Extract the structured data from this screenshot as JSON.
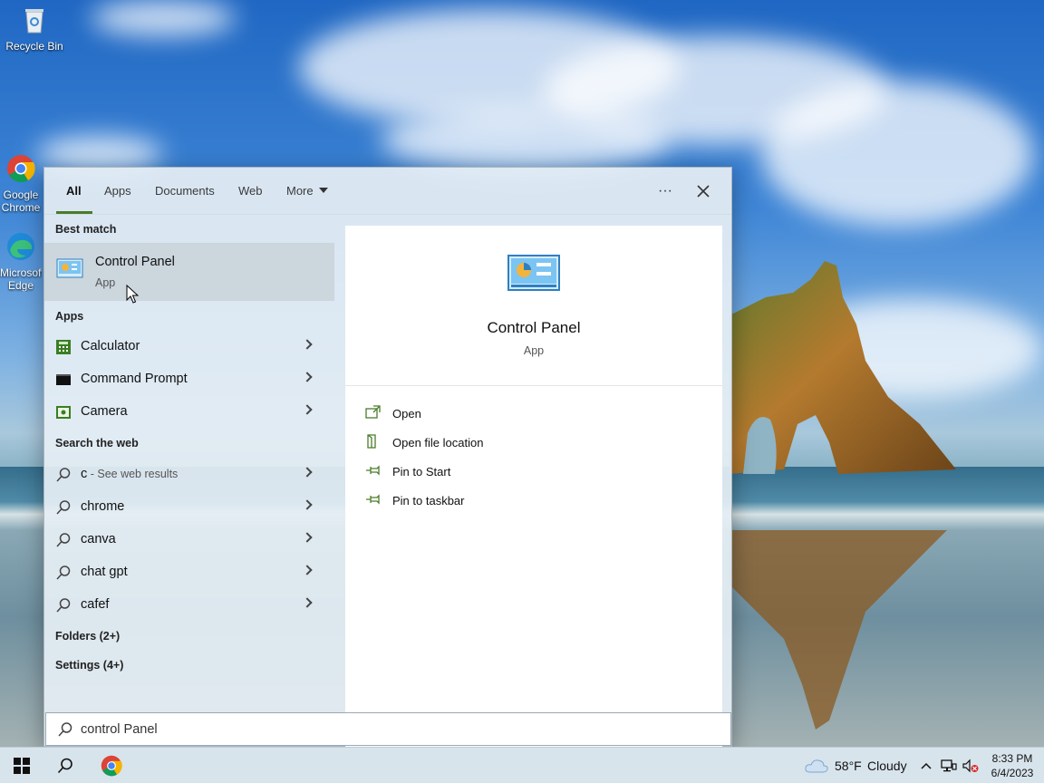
{
  "desktop": {
    "icons": [
      {
        "label": "Recycle Bin",
        "icon": "recycle-bin-icon"
      },
      {
        "label": "Google Chrome",
        "icon": "chrome-icon"
      },
      {
        "label": "Microsoft Edge",
        "icon": "edge-icon"
      }
    ]
  },
  "search": {
    "tabs": [
      {
        "label": "All",
        "active": true
      },
      {
        "label": "Apps"
      },
      {
        "label": "Documents"
      },
      {
        "label": "Web"
      },
      {
        "label": "More"
      }
    ],
    "more_options_label": "···",
    "close_label": "✕",
    "best_match": {
      "heading": "Best match",
      "title": "Control Panel",
      "subtitle": "App",
      "icon": "control-panel-icon"
    },
    "apps": {
      "heading": "Apps",
      "items": [
        {
          "label": "Calculator",
          "icon": "calculator-icon"
        },
        {
          "label": "Command Prompt",
          "icon": "command-prompt-icon"
        },
        {
          "label": "Camera",
          "icon": "camera-icon"
        }
      ]
    },
    "web": {
      "heading": "Search the web",
      "items": [
        {
          "label": "c",
          "sub": " - See web results"
        },
        {
          "label": "chrome"
        },
        {
          "label": "canva"
        },
        {
          "label": "chat gpt"
        },
        {
          "label": "cafef"
        }
      ]
    },
    "folders_label": "Folders (2+)",
    "settings_label": "Settings (4+)",
    "preview": {
      "title": "Control Panel",
      "subtitle": "App",
      "actions": [
        {
          "label": "Open",
          "icon": "open-icon"
        },
        {
          "label": "Open file location",
          "icon": "file-location-icon"
        },
        {
          "label": "Pin to Start",
          "icon": "pin-icon"
        },
        {
          "label": "Pin to taskbar",
          "icon": "pin-icon"
        }
      ]
    },
    "query": "control Panel"
  },
  "taskbar": {
    "weather_temp": "58°F",
    "weather_text": "Cloudy",
    "time": "8:33 PM",
    "date": "6/4/2023"
  },
  "colors": {
    "accent": "#4a7c2b",
    "panel_bg": "#e5eef4",
    "taskbar_bg": "#d8e4ec"
  }
}
